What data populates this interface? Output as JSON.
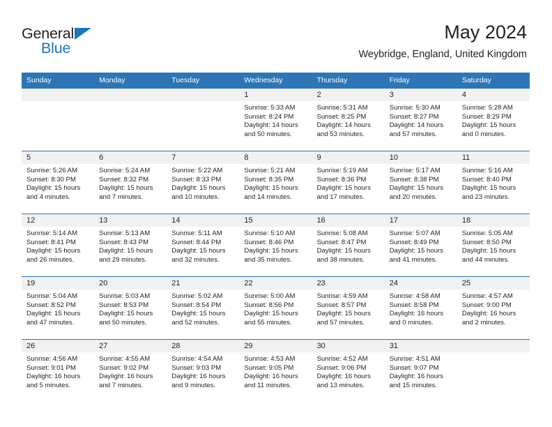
{
  "brand": {
    "name_top": "General",
    "name_bottom": "Blue",
    "triangle_color": "#1b75bb"
  },
  "header": {
    "title": "May 2024",
    "subtitle": "Weybridge, England, United Kingdom"
  },
  "theme": {
    "header_blue": "#2e75b6",
    "date_band_gray": "#f1f1f1",
    "text_color": "#231f20"
  },
  "calendar": {
    "weekday_headers": [
      "Sunday",
      "Monday",
      "Tuesday",
      "Wednesday",
      "Thursday",
      "Friday",
      "Saturday"
    ],
    "weeks": [
      [
        {
          "day": "",
          "lines": []
        },
        {
          "day": "",
          "lines": []
        },
        {
          "day": "",
          "lines": []
        },
        {
          "day": "1",
          "lines": [
            "Sunrise: 5:33 AM",
            "Sunset: 8:24 PM",
            "Daylight: 14 hours",
            "and 50 minutes."
          ]
        },
        {
          "day": "2",
          "lines": [
            "Sunrise: 5:31 AM",
            "Sunset: 8:25 PM",
            "Daylight: 14 hours",
            "and 53 minutes."
          ]
        },
        {
          "day": "3",
          "lines": [
            "Sunrise: 5:30 AM",
            "Sunset: 8:27 PM",
            "Daylight: 14 hours",
            "and 57 minutes."
          ]
        },
        {
          "day": "4",
          "lines": [
            "Sunrise: 5:28 AM",
            "Sunset: 8:29 PM",
            "Daylight: 15 hours",
            "and 0 minutes."
          ]
        }
      ],
      [
        {
          "day": "5",
          "lines": [
            "Sunrise: 5:26 AM",
            "Sunset: 8:30 PM",
            "Daylight: 15 hours",
            "and 4 minutes."
          ]
        },
        {
          "day": "6",
          "lines": [
            "Sunrise: 5:24 AM",
            "Sunset: 8:32 PM",
            "Daylight: 15 hours",
            "and 7 minutes."
          ]
        },
        {
          "day": "7",
          "lines": [
            "Sunrise: 5:22 AM",
            "Sunset: 8:33 PM",
            "Daylight: 15 hours",
            "and 10 minutes."
          ]
        },
        {
          "day": "8",
          "lines": [
            "Sunrise: 5:21 AM",
            "Sunset: 8:35 PM",
            "Daylight: 15 hours",
            "and 14 minutes."
          ]
        },
        {
          "day": "9",
          "lines": [
            "Sunrise: 5:19 AM",
            "Sunset: 8:36 PM",
            "Daylight: 15 hours",
            "and 17 minutes."
          ]
        },
        {
          "day": "10",
          "lines": [
            "Sunrise: 5:17 AM",
            "Sunset: 8:38 PM",
            "Daylight: 15 hours",
            "and 20 minutes."
          ]
        },
        {
          "day": "11",
          "lines": [
            "Sunrise: 5:16 AM",
            "Sunset: 8:40 PM",
            "Daylight: 15 hours",
            "and 23 minutes."
          ]
        }
      ],
      [
        {
          "day": "12",
          "lines": [
            "Sunrise: 5:14 AM",
            "Sunset: 8:41 PM",
            "Daylight: 15 hours",
            "and 26 minutes."
          ]
        },
        {
          "day": "13",
          "lines": [
            "Sunrise: 5:13 AM",
            "Sunset: 8:43 PM",
            "Daylight: 15 hours",
            "and 29 minutes."
          ]
        },
        {
          "day": "14",
          "lines": [
            "Sunrise: 5:11 AM",
            "Sunset: 8:44 PM",
            "Daylight: 15 hours",
            "and 32 minutes."
          ]
        },
        {
          "day": "15",
          "lines": [
            "Sunrise: 5:10 AM",
            "Sunset: 8:46 PM",
            "Daylight: 15 hours",
            "and 35 minutes."
          ]
        },
        {
          "day": "16",
          "lines": [
            "Sunrise: 5:08 AM",
            "Sunset: 8:47 PM",
            "Daylight: 15 hours",
            "and 38 minutes."
          ]
        },
        {
          "day": "17",
          "lines": [
            "Sunrise: 5:07 AM",
            "Sunset: 8:49 PM",
            "Daylight: 15 hours",
            "and 41 minutes."
          ]
        },
        {
          "day": "18",
          "lines": [
            "Sunrise: 5:05 AM",
            "Sunset: 8:50 PM",
            "Daylight: 15 hours",
            "and 44 minutes."
          ]
        }
      ],
      [
        {
          "day": "19",
          "lines": [
            "Sunrise: 5:04 AM",
            "Sunset: 8:52 PM",
            "Daylight: 15 hours",
            "and 47 minutes."
          ]
        },
        {
          "day": "20",
          "lines": [
            "Sunrise: 5:03 AM",
            "Sunset: 8:53 PM",
            "Daylight: 15 hours",
            "and 50 minutes."
          ]
        },
        {
          "day": "21",
          "lines": [
            "Sunrise: 5:02 AM",
            "Sunset: 8:54 PM",
            "Daylight: 15 hours",
            "and 52 minutes."
          ]
        },
        {
          "day": "22",
          "lines": [
            "Sunrise: 5:00 AM",
            "Sunset: 8:56 PM",
            "Daylight: 15 hours",
            "and 55 minutes."
          ]
        },
        {
          "day": "23",
          "lines": [
            "Sunrise: 4:59 AM",
            "Sunset: 8:57 PM",
            "Daylight: 15 hours",
            "and 57 minutes."
          ]
        },
        {
          "day": "24",
          "lines": [
            "Sunrise: 4:58 AM",
            "Sunset: 8:58 PM",
            "Daylight: 16 hours",
            "and 0 minutes."
          ]
        },
        {
          "day": "25",
          "lines": [
            "Sunrise: 4:57 AM",
            "Sunset: 9:00 PM",
            "Daylight: 16 hours",
            "and 2 minutes."
          ]
        }
      ],
      [
        {
          "day": "26",
          "lines": [
            "Sunrise: 4:56 AM",
            "Sunset: 9:01 PM",
            "Daylight: 16 hours",
            "and 5 minutes."
          ]
        },
        {
          "day": "27",
          "lines": [
            "Sunrise: 4:55 AM",
            "Sunset: 9:02 PM",
            "Daylight: 16 hours",
            "and 7 minutes."
          ]
        },
        {
          "day": "28",
          "lines": [
            "Sunrise: 4:54 AM",
            "Sunset: 9:03 PM",
            "Daylight: 16 hours",
            "and 9 minutes."
          ]
        },
        {
          "day": "29",
          "lines": [
            "Sunrise: 4:53 AM",
            "Sunset: 9:05 PM",
            "Daylight: 16 hours",
            "and 11 minutes."
          ]
        },
        {
          "day": "30",
          "lines": [
            "Sunrise: 4:52 AM",
            "Sunset: 9:06 PM",
            "Daylight: 16 hours",
            "and 13 minutes."
          ]
        },
        {
          "day": "31",
          "lines": [
            "Sunrise: 4:51 AM",
            "Sunset: 9:07 PM",
            "Daylight: 16 hours",
            "and 15 minutes."
          ]
        },
        {
          "day": "",
          "lines": []
        }
      ]
    ]
  }
}
